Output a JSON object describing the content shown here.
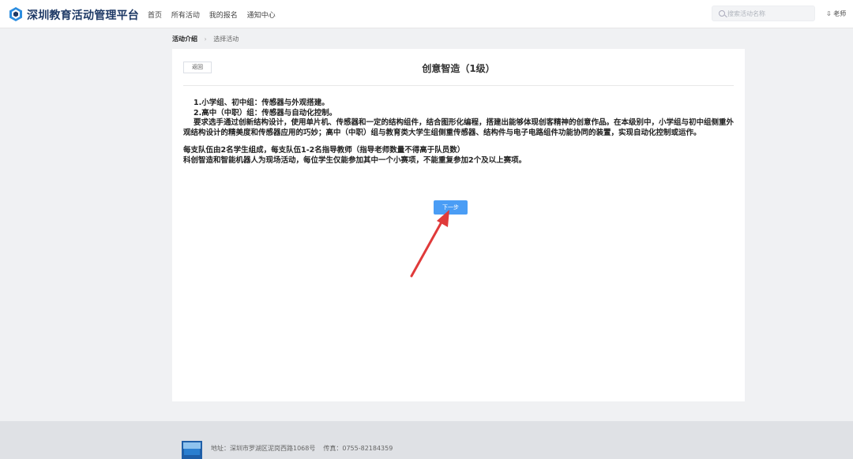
{
  "header": {
    "brand": "深圳教育活动管理平台",
    "nav": [
      "首页",
      "所有活动",
      "我的报名",
      "通知中心"
    ],
    "search_placeholder": "搜索活动名称",
    "user": "老师"
  },
  "breadcrumb": {
    "first": "活动介绍",
    "second": "选择活动"
  },
  "card": {
    "back_label": "返回",
    "title": "创意智造（1级）",
    "lines": [
      "1.小学组、初中组：传感器与外观搭建。",
      "2.高中（中职）组：传感器与自动化控制。",
      "要求选手通过创新结构设计，使用单片机、传感器和一定的结构组件，结合图形化编程，搭建出能够体现创客精神的创意作品。在本级别中，小学组与初中组侧重外观结构设计的精美度和传感器应用的巧妙；高中（中职）组与教育类大学生组侧重传感器、结构件与电子电路组件功能协同的装置，实现自动化控制或运作。",
      "每支队伍由2名学生组成，每支队伍1-2名指导教师（指导老师数量不得高于队员数）",
      "科创智造和智能机器人为现场活动，每位学生仅能参加其中一个小赛项，不能重复参加2个及以上赛项。"
    ],
    "next_label": "下一步"
  },
  "footer": {
    "address": "地址：深圳市罗湖区泥岗西路1068号",
    "fax": "传真：0755-82184359"
  },
  "colors": {
    "brand": "#1f3a66",
    "primary_button": "#4a9df5",
    "arrow": "#e03a3a"
  }
}
